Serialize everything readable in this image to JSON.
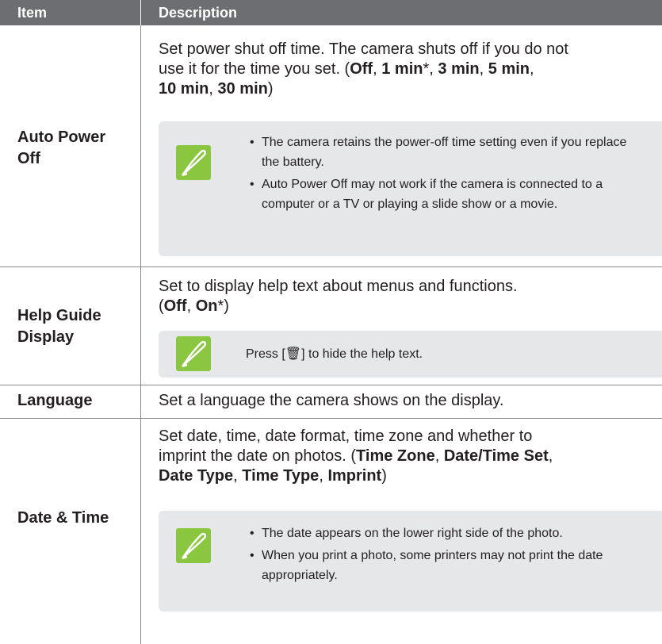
{
  "header": {
    "col_item": "Item",
    "col_description": "Description"
  },
  "rows": [
    {
      "item_line1": "Auto Power",
      "item_line2": "Off",
      "desc_line1": "Set power shut off time. The camera shuts off if you do not",
      "desc_line2_a": "use it for the time you set. (",
      "desc_line2_b1": "Off",
      "desc_line2_b2": "1 min",
      "desc_line2_star": "*",
      "desc_line2_b3": "3 min",
      "desc_line2_b4": "5 min",
      "desc_line3_b1": "10 min",
      "desc_line3_b2": "30 min",
      "desc_line3_end": ")",
      "note_bullets": [
        "The camera retains the power-off time setting even if you replace the battery.",
        "Auto Power Off may not work if the camera is connected to a computer or a TV or playing a slide show or a movie."
      ]
    },
    {
      "item_line1": "Help Guide",
      "item_line2": "Display",
      "desc_line1": "Set to display help text about menus and functions.",
      "desc_line2_open": "(",
      "desc_line2_b1": "Off",
      "desc_line2_b2": "On",
      "desc_line2_end": "*)",
      "note_text_a": "Press [",
      "note_text_icon": "🗑",
      "note_text_b": "] to hide the help text."
    },
    {
      "item": "Language",
      "desc": "Set a language the camera shows on the display."
    },
    {
      "item": "Date & Time",
      "desc_line1": "Set date, time, date format, time zone and whether to",
      "desc_line2_a": "imprint the date on photos. (",
      "desc_line2_b1": "Time Zone",
      "desc_line2_b2": "Date/Time Set",
      "desc_line3_b1": "Date Type",
      "desc_line3_b2": "Time Type",
      "desc_line3_b3": "Imprint",
      "desc_line3_end": ")",
      "note_bullets": [
        "The date appears on the lower right side of the photo.",
        "When you print a photo, some printers may not print the date appropriately."
      ]
    }
  ],
  "colors": {
    "header_bg": "#6d6e71",
    "note_bg": "#e6e7e8",
    "icon_bg": "#8ac640"
  },
  "icons": {
    "note": "pen-nib-note-icon",
    "bullet": "•"
  }
}
